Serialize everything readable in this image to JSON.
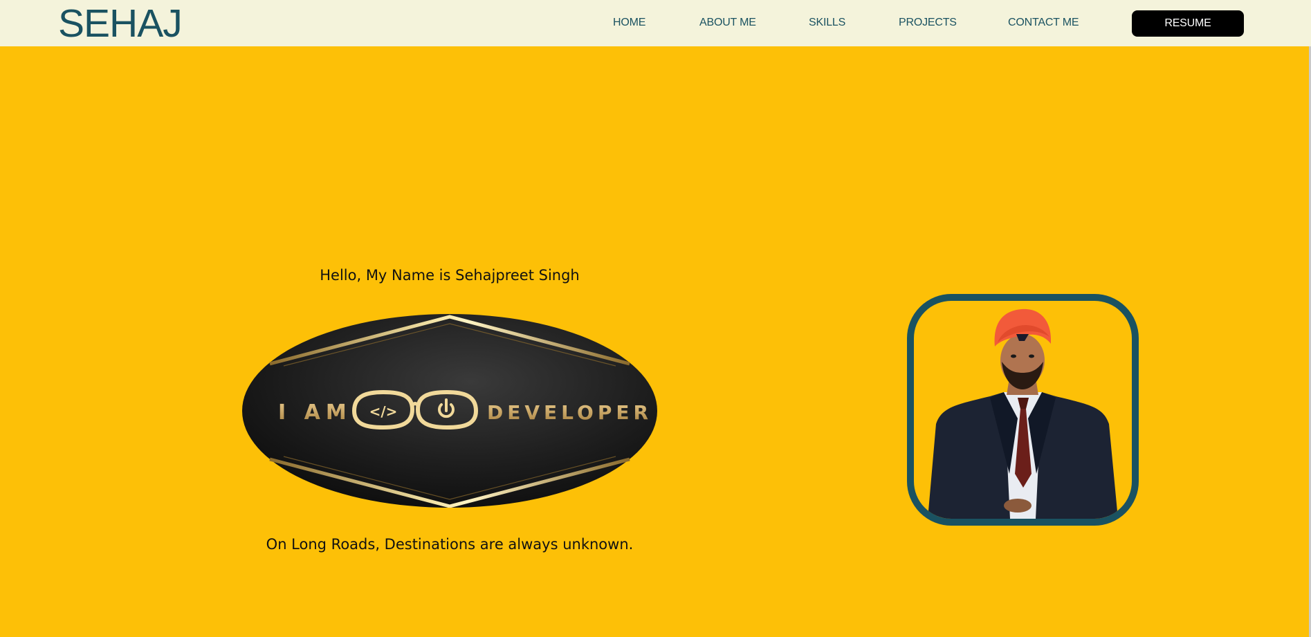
{
  "header": {
    "logo": "SEHAJ",
    "nav": [
      "HOME",
      "ABOUT ME",
      "SKILLS",
      "PROJECTS",
      "CONTACT ME"
    ],
    "resume_label": "RESUME"
  },
  "hero": {
    "greeting": "Hello, My Name is Sehajpreet Singh",
    "badge": {
      "left_text": "I AM",
      "right_text": "DEVELOPER",
      "code_glyph": "</>"
    },
    "tagline": "On Long Roads, Destinations are always unknown."
  },
  "colors": {
    "page_bg": "#fdc007",
    "nav_bg": "#f4f3db",
    "brand": "#1a5261",
    "gold": "#d9b76a"
  },
  "icons": {
    "glasses": "glasses-icon",
    "power": "power-icon"
  }
}
